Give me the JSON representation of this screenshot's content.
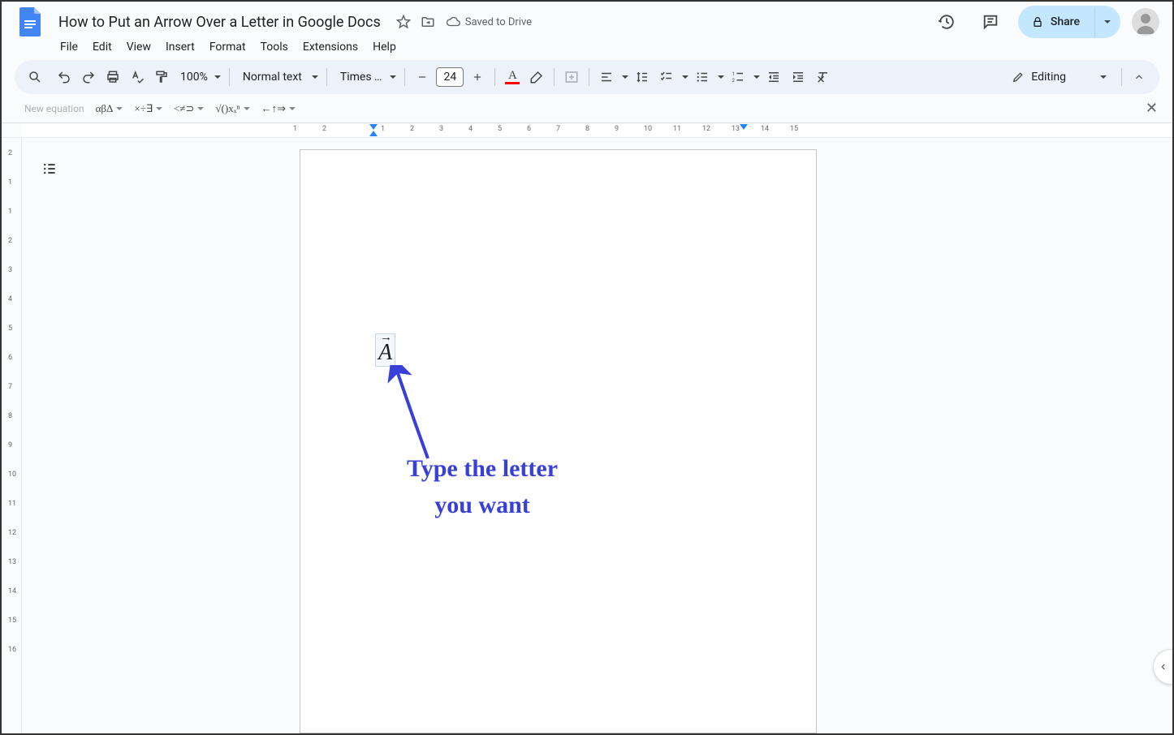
{
  "header": {
    "doc_title": "How to Put an Arrow Over a Letter in Google Docs",
    "saved_status": "Saved to Drive"
  },
  "menus": [
    "File",
    "Edit",
    "View",
    "Insert",
    "Format",
    "Tools",
    "Extensions",
    "Help"
  ],
  "share": {
    "label": "Share"
  },
  "toolbar": {
    "zoom": "100%",
    "paragraph_style": "Normal text",
    "font": "Times …",
    "font_size": "24",
    "editing_mode": "Editing"
  },
  "equation_bar": {
    "label": "New equation",
    "groups": [
      "αβΔ",
      "×÷∃",
      "<≠⊃",
      "√()xₓⁿ",
      "←↑⇒"
    ]
  },
  "document": {
    "equation_letter": "A",
    "equation_overhead": "→"
  },
  "annotation": {
    "line1": "Type the letter",
    "line2": "you want"
  },
  "ruler": {
    "h_negative": [
      2,
      1
    ],
    "h_positive": [
      1,
      2,
      3,
      4,
      5,
      6,
      7,
      8,
      9,
      10,
      11,
      12,
      13,
      14,
      15
    ],
    "v": [
      2,
      1,
      1,
      2,
      3,
      4,
      5,
      6,
      7,
      8,
      9,
      10,
      11,
      12,
      13,
      14,
      15,
      16
    ]
  }
}
